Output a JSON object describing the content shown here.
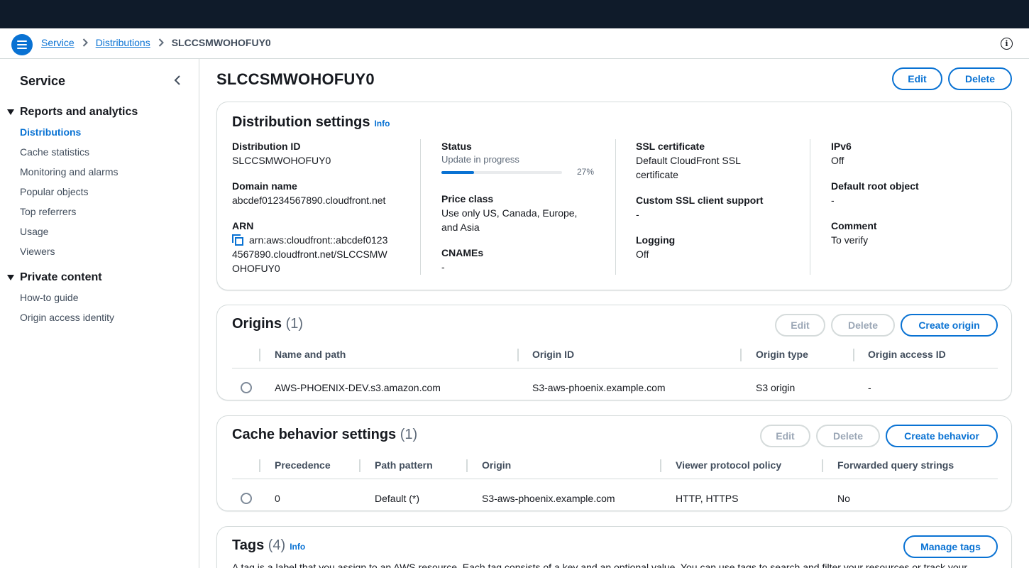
{
  "breadcrumb": {
    "items": [
      "Service",
      "Distributions"
    ],
    "current": "SLCCSMWOHOFUY0"
  },
  "sidebar": {
    "title": "Service",
    "sections": [
      {
        "label": "Reports and analytics",
        "items": [
          "Distributions",
          "Cache statistics",
          "Monitoring and alarms",
          "Popular objects",
          "Top referrers",
          "Usage",
          "Viewers"
        ]
      },
      {
        "label": "Private content",
        "items": [
          "How-to guide",
          "Origin access identity"
        ]
      }
    ],
    "active_item": "Distributions"
  },
  "page": {
    "title": "SLCCSMWOHOFUY0",
    "edit_label": "Edit",
    "delete_label": "Delete"
  },
  "distribution_settings": {
    "title": "Distribution settings",
    "info_label": "Info",
    "distribution_id_label": "Distribution ID",
    "distribution_id": "SLCCSMWOHOFUY0",
    "domain_name_label": "Domain name",
    "domain_name": "abcdef01234567890.cloudfront.net",
    "arn_label": "ARN",
    "arn_lines": [
      "arn:aws:cloudfront::abcdef0123",
      "4567890.cloudfront.net/SLCCSMW",
      "OHOFUY0"
    ],
    "status_label": "Status",
    "status_text": "Update in progress",
    "status_progress": 0.27,
    "status_progress_label": "27%",
    "price_class_label": "Price class",
    "price_class_lines": [
      "Use only US, Canada, Europe,",
      "and Asia"
    ],
    "cnames_label": "CNAMEs",
    "cnames": "-",
    "ssl_label": "SSL certificate",
    "ssl_lines": [
      "Default CloudFront SSL",
      "certificate"
    ],
    "custom_ssl_label": "Custom SSL client support",
    "custom_ssl": "-",
    "logging_label": "Logging",
    "logging": "Off",
    "ipv6_label": "IPv6",
    "ipv6": "Off",
    "root_object_label": "Default root object",
    "root_object": "-",
    "comment_label": "Comment",
    "comment": "To verify"
  },
  "origins": {
    "title": "Origins",
    "count": "(1)",
    "edit_label": "Edit",
    "delete_label": "Delete",
    "create_label": "Create origin",
    "columns": [
      "Name and path",
      "Origin ID",
      "Origin type",
      "Origin access ID"
    ],
    "rows": [
      [
        "AWS-PHOENIX-DEV.s3.amazon.com",
        "S3-aws-phoenix.example.com",
        "S3 origin",
        "-"
      ]
    ]
  },
  "cache_behaviors": {
    "title": "Cache behavior settings",
    "count": "(1)",
    "edit_label": "Edit",
    "delete_label": "Delete",
    "create_label": "Create behavior",
    "columns": [
      "Precedence",
      "Path pattern",
      "Origin",
      "Viewer protocol policy",
      "Forwarded query strings"
    ],
    "rows": [
      [
        "0",
        "Default (*)",
        "S3-aws-phoenix.example.com",
        "HTTP, HTTPS",
        "No"
      ]
    ]
  },
  "tags": {
    "title": "Tags",
    "count": "(4)",
    "info_label": "Info",
    "manage_label": "Manage tags",
    "description": "A tag is a label that you assign to an AWS resource. Each tag consists of a key and an optional value. You can use tags to search and filter your resources or track your"
  }
}
